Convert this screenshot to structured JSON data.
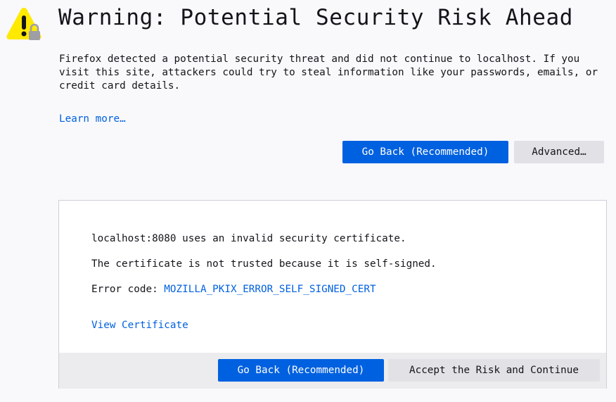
{
  "header": {
    "title": "Warning: Potential Security Risk Ahead",
    "icon": "warning-lock-icon"
  },
  "intro": {
    "description": "Firefox detected a potential security threat and did not continue to localhost. If you visit this site, attackers could try to steal information like your passwords, emails, or credit card details.",
    "learn_more": "Learn more…"
  },
  "actions": {
    "go_back": "Go Back (Recommended)",
    "advanced": "Advanced…"
  },
  "advanced_panel": {
    "invalid_cert": "localhost:8080 uses an invalid security certificate.",
    "reason": "The certificate is not trusted because it is self-signed.",
    "error_code_label": "Error code: ",
    "error_code": "MOZILLA_PKIX_ERROR_SELF_SIGNED_CERT",
    "view_certificate": "View Certificate",
    "go_back": "Go Back (Recommended)",
    "accept": "Accept the Risk and Continue"
  },
  "colors": {
    "accent": "#0061e0",
    "warning_yellow": "#ffe900",
    "background": "#f9f9fb"
  }
}
